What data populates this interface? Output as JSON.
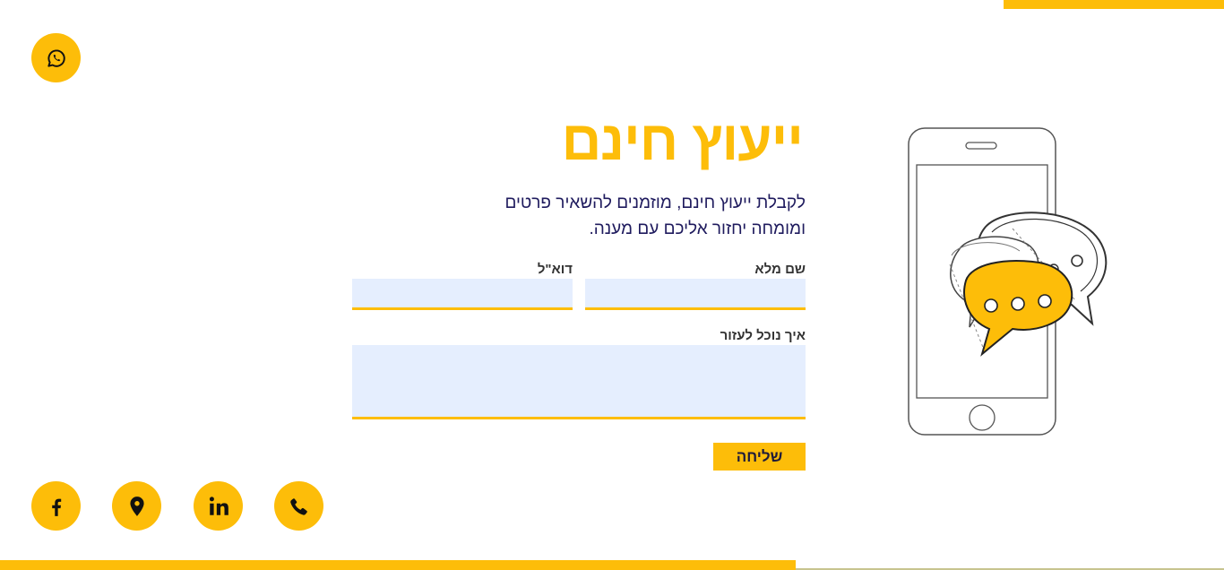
{
  "hero": {
    "title": "ייעוץ חינם",
    "subtitle": "לקבלת ייעוץ חינם, מוזמנים להשאיר פרטים ומומחה יחזור אליכם עם מענה."
  },
  "form": {
    "name_label": "שם מלא",
    "email_label": "דוא\"ל",
    "help_label": "איך נוכל לעזור",
    "name_value": "",
    "email_value": "",
    "help_value": "",
    "submit_label": "שליחה"
  },
  "social": {
    "items": [
      {
        "icon": "whatsapp-icon"
      },
      {
        "icon": "facebook-icon"
      },
      {
        "icon": "location-pin-icon"
      },
      {
        "icon": "linkedin-icon"
      },
      {
        "icon": "phone-icon"
      }
    ]
  },
  "colors": {
    "accent": "#fdbd09",
    "text_dark": "#1f1b5e",
    "field_bg": "#e5eefe"
  }
}
